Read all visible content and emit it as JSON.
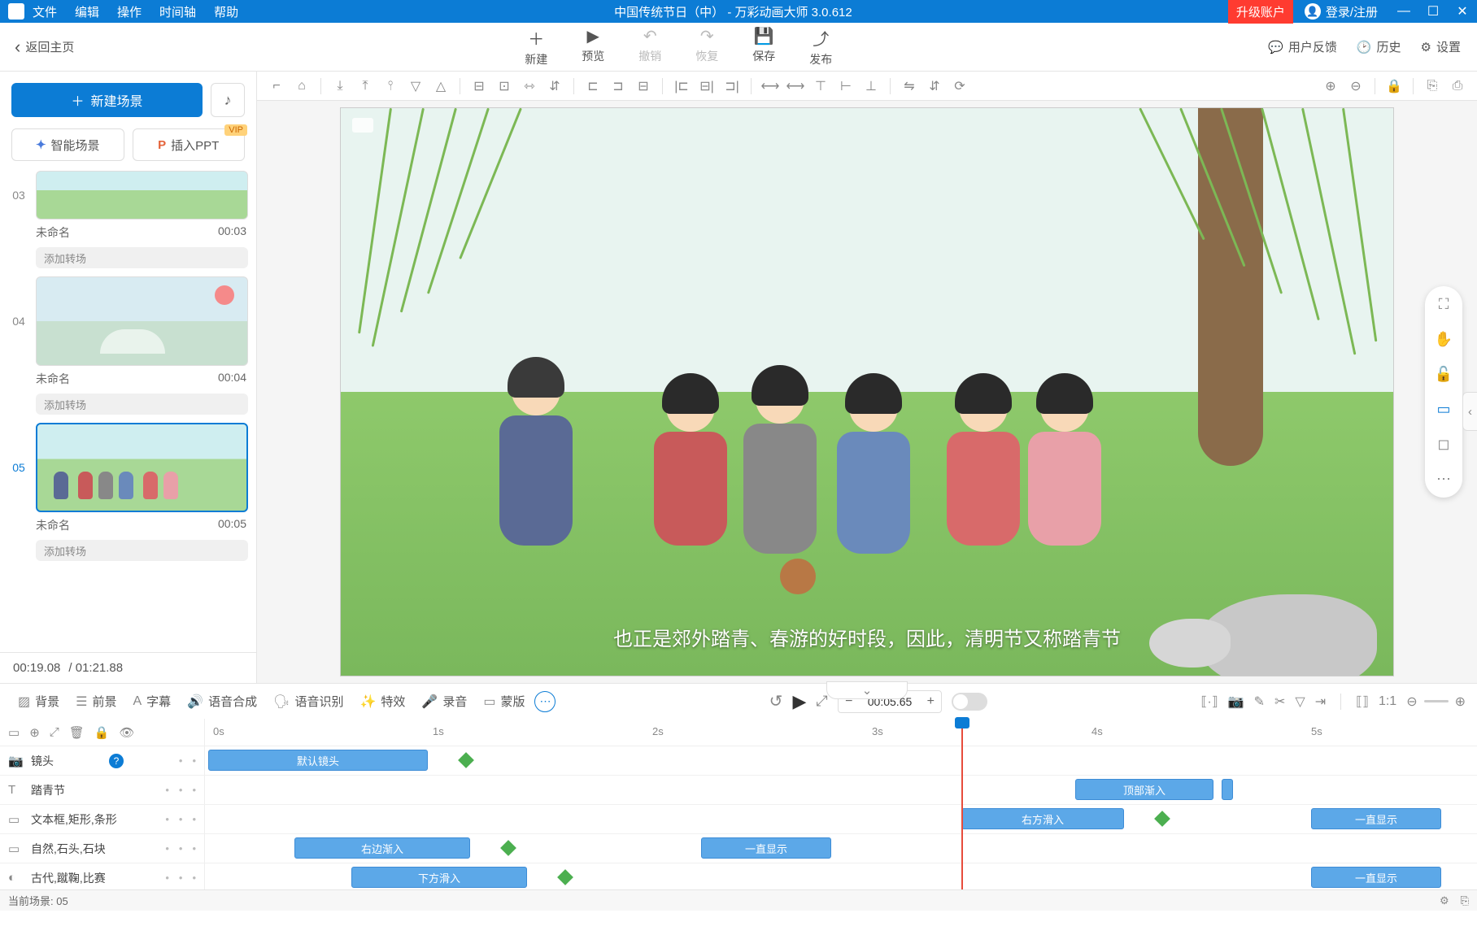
{
  "titlebar": {
    "menus": [
      "文件",
      "编辑",
      "操作",
      "时间轴",
      "帮助"
    ],
    "title": "中国传统节日（中）  - 万彩动画大师 3.0.612",
    "upgrade": "升级账户",
    "login": "登录/注册"
  },
  "toolbar": {
    "back": "返回主页",
    "buttons": [
      {
        "icon": "＋",
        "label": "新建"
      },
      {
        "icon": "▶",
        "label": "预览"
      },
      {
        "icon": "↶",
        "label": "撤销",
        "disabled": true
      },
      {
        "icon": "↷",
        "label": "恢复",
        "disabled": true
      },
      {
        "icon": "💾",
        "label": "保存"
      },
      {
        "icon": "⤴",
        "label": "发布"
      }
    ],
    "right": [
      {
        "icon": "💬",
        "label": "用户反馈"
      },
      {
        "icon": "🕑",
        "label": "历史"
      },
      {
        "icon": "⚙",
        "label": "设置"
      }
    ]
  },
  "sidebar": {
    "new_scene": "新建场景",
    "ai_scene": "智能场景",
    "insert_ppt": "插入PPT",
    "vip": "VIP",
    "scenes": [
      {
        "idx": "03",
        "name": "未命名",
        "dur": "00:03",
        "trans": "添加转场"
      },
      {
        "idx": "04",
        "name": "未命名",
        "dur": "00:04",
        "trans": "添加转场"
      },
      {
        "idx": "05",
        "name": "未命名",
        "dur": "00:05",
        "trans": "添加转场",
        "active": true
      }
    ],
    "footer_cur": "00:19.08",
    "footer_total": "/ 01:21.88"
  },
  "canvas": {
    "subtitle": "也正是郊外踏青、春游的好时段，因此，清明节又称踏青节"
  },
  "controls": {
    "left": [
      {
        "icon": "▨",
        "label": "背景"
      },
      {
        "icon": "☰",
        "label": "前景"
      },
      {
        "icon": "A",
        "label": "字幕"
      },
      {
        "icon": "🔊",
        "label": "语音合成"
      },
      {
        "icon": "🗣",
        "label": "语音识别"
      },
      {
        "icon": "✨",
        "label": "特效"
      },
      {
        "icon": "🎤",
        "label": "录音"
      },
      {
        "icon": "▭",
        "label": "蒙版"
      }
    ],
    "time": "00:05.65"
  },
  "timeline": {
    "ruler": [
      "0s",
      "1s",
      "2s",
      "3s",
      "4s",
      "5s"
    ],
    "tracks": [
      {
        "icon": "📷",
        "label": "镜头",
        "help": true
      },
      {
        "icon": "T",
        "label": "踏青节"
      },
      {
        "icon": "▭",
        "label": "文本框,矩形,条形"
      },
      {
        "icon": "▭",
        "label": "自然,石头,石块"
      },
      {
        "icon": "◐",
        "label": "古代,蹴鞠,比赛"
      }
    ],
    "clips": {
      "default_cam": "默认镜头",
      "top_in": "顶部渐入",
      "right_slide": "右方滑入",
      "always_show": "一直显示",
      "right_fade": "右边渐入",
      "bottom_slide": "下方滑入"
    }
  },
  "statusbar": {
    "current": "当前场景: 05"
  }
}
